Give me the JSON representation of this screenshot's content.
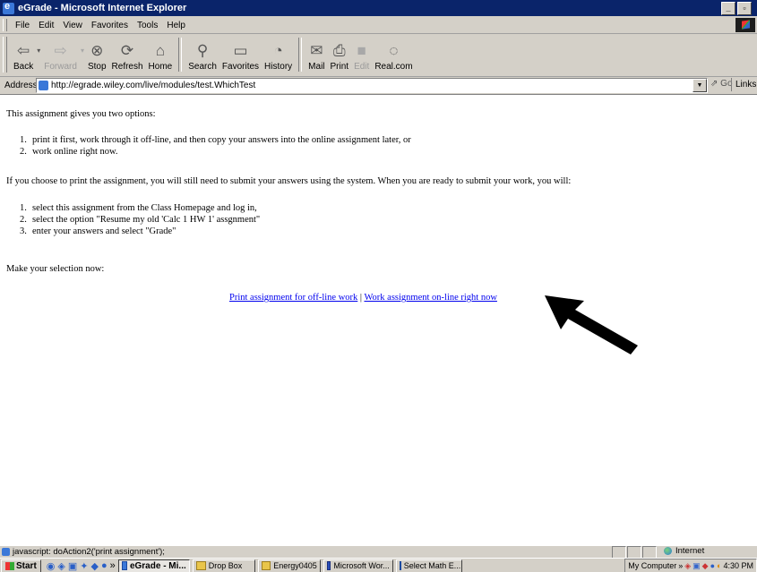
{
  "window": {
    "title": "eGrade - Microsoft Internet Explorer"
  },
  "menu": {
    "items": [
      "File",
      "Edit",
      "View",
      "Favorites",
      "Tools",
      "Help"
    ]
  },
  "toolbar": {
    "back": "Back",
    "forward": "Forward",
    "stop": "Stop",
    "refresh": "Refresh",
    "home": "Home",
    "search": "Search",
    "favorites": "Favorites",
    "history": "History",
    "mail": "Mail",
    "print": "Print",
    "edit": "Edit",
    "realcom": "Real.com"
  },
  "address": {
    "label": "Address",
    "url": "http://egrade.wiley.com/live/modules/test.WhichTest",
    "go": "Go",
    "links": "Links"
  },
  "content": {
    "intro": "This assignment gives you two options:",
    "options": [
      "print it first, work through it off-line, and then copy your answers into the online assignment later, or",
      "work online right now."
    ],
    "print_note": "If you choose to print the assignment, you will still need to submit your answers using the system. When you are ready to submit your work, you will:",
    "steps": [
      "select this assignment from the Class Homepage and log in,",
      "select the option \"Resume my old 'Calc 1 HW 1' assgnment\"",
      "enter your answers and select \"Grade\""
    ],
    "prompt": "Make your selection now:",
    "link_print": "Print assignment for off-line work",
    "separator": "|",
    "link_online": "Work assignment on-line right now"
  },
  "status": {
    "text": "javascript: doAction2('print assignment');",
    "zone": "Internet"
  },
  "taskbar": {
    "start": "Start",
    "chevron": "»",
    "tasks": [
      {
        "label": "eGrade - Mi...",
        "icon": "ie-icon",
        "active": true
      },
      {
        "label": "Drop Box",
        "icon": "folder-icon",
        "active": false
      },
      {
        "label": "Energy0405",
        "icon": "folder-icon",
        "active": false
      },
      {
        "label": "Microsoft Wor...",
        "icon": "word-icon",
        "active": false
      },
      {
        "label": "Select Math E...",
        "icon": "ie-icon",
        "active": false
      }
    ],
    "my_computer": "My Computer",
    "clock": "4:30 PM"
  },
  "colors": {
    "titlebar": "#0a246a",
    "link": "#0000ee",
    "chrome": "#d4d0c8"
  }
}
